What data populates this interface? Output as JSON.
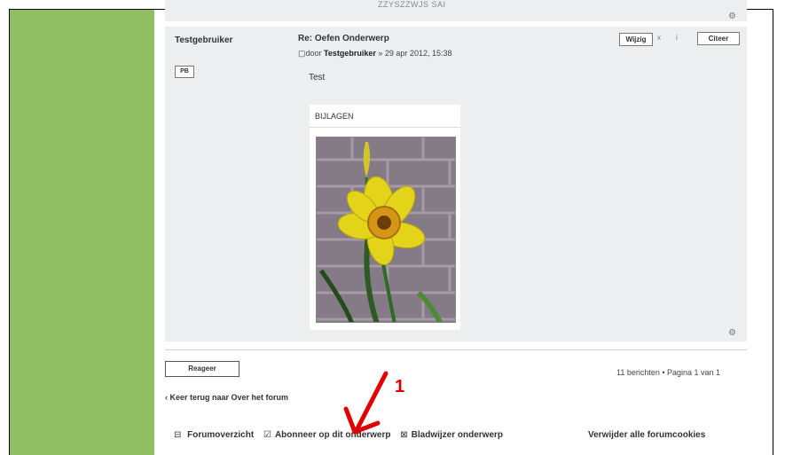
{
  "previous_post": {
    "snippet": "ZZYSZZWJS SAI"
  },
  "post": {
    "author": "Testgebruiker",
    "pm_label": "PB",
    "title": "Re: Oefen Onderwerp",
    "meta_prefix": "door",
    "meta_author": "Testgebruiker",
    "meta_date": " » 29 apr 2012, 15:38",
    "body": "Test",
    "edit_label": "Wijzig",
    "delete_label": "x",
    "info_label": "i",
    "quote_label": "Citeer",
    "attachments_label": "BIJLAGEN"
  },
  "actions": {
    "reply_label": "Reageer",
    "pagination": "11 berichten • Pagina 1 van 1",
    "back_link": "‹ Keer terug naar Over het forum"
  },
  "footer": {
    "forum_overview": "Forumoverzicht",
    "subscribe": "Abonneer op dit onderwerp",
    "bookmark": "Bladwijzer onderwerp",
    "delete_cookies": "Verwijder alle forumcookies"
  },
  "annotation": {
    "number": "1",
    "color": "#e00000"
  },
  "colors": {
    "sidebar_green": "#8fbf62",
    "post_bg": "#eceef0"
  }
}
